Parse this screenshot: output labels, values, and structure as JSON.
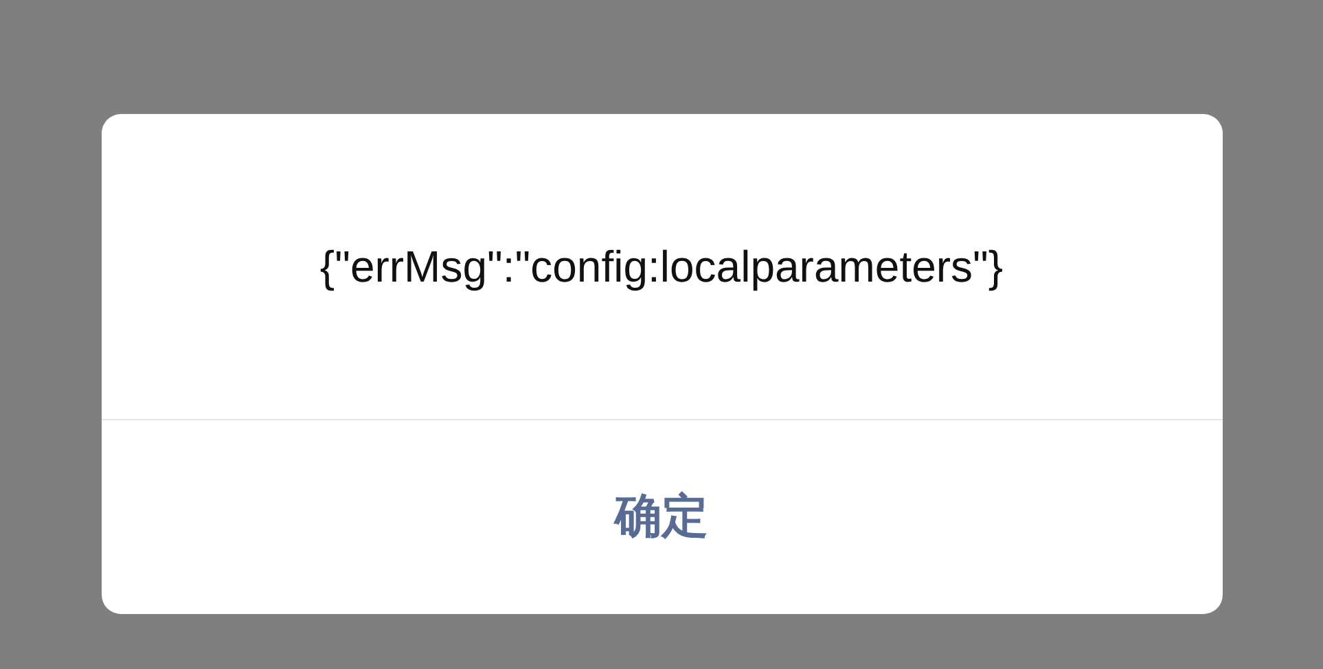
{
  "dialog": {
    "message": "{\"errMsg\":\"config:localparameters\"}",
    "buttons": [
      {
        "label": "确定"
      }
    ]
  }
}
